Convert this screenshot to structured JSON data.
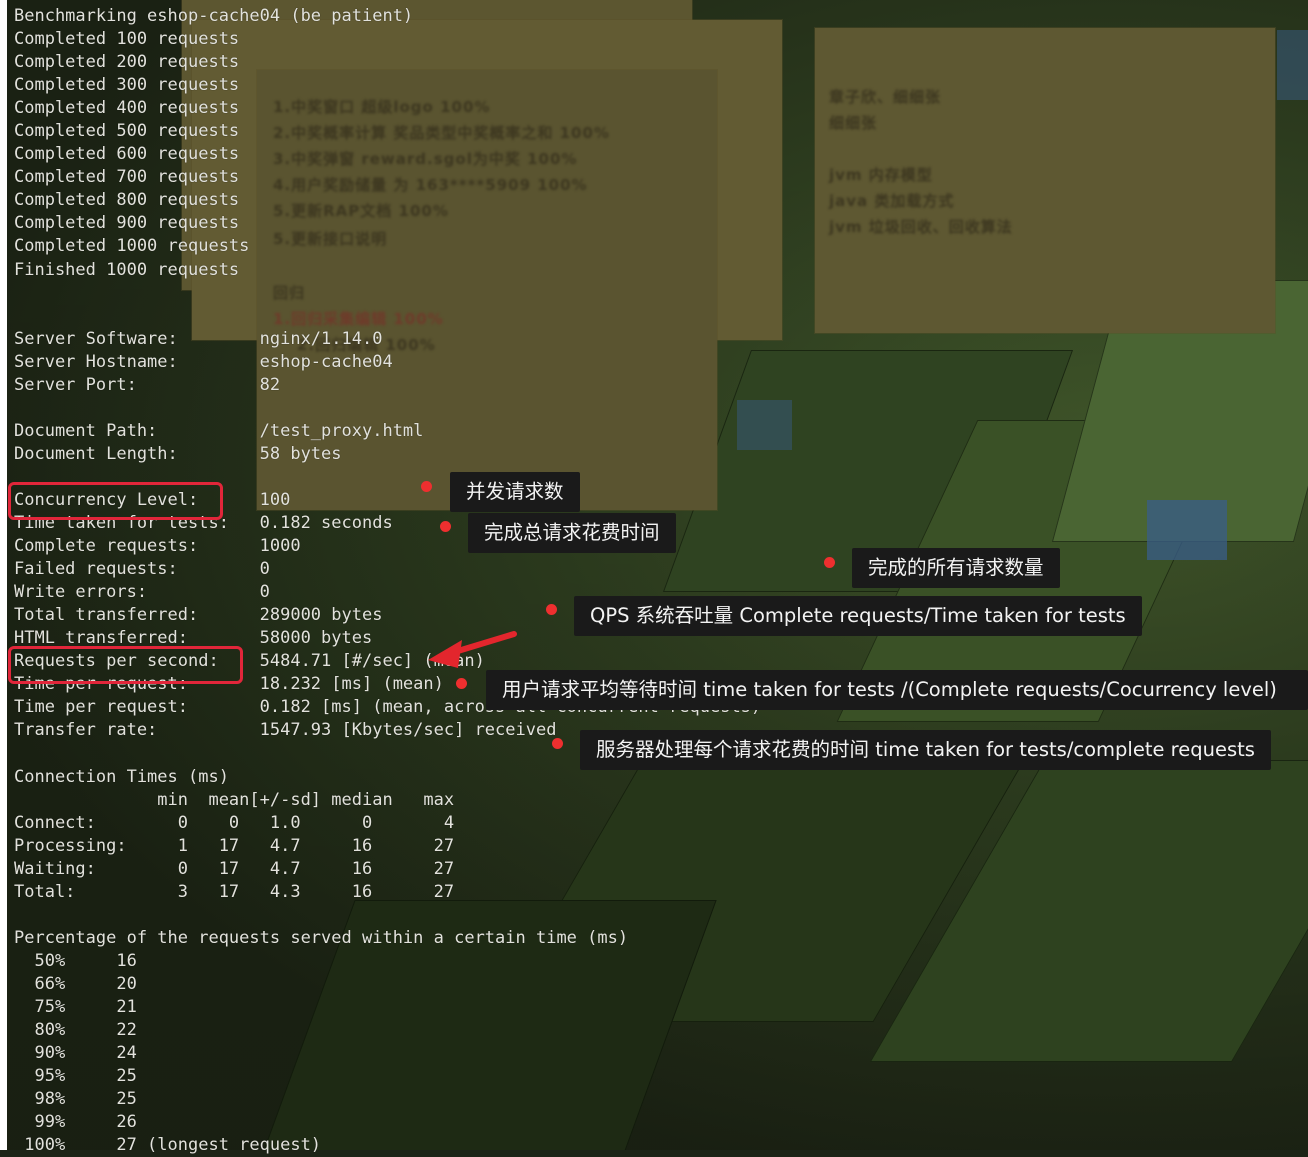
{
  "terminal": {
    "lines": [
      "Benchmarking eshop-cache04 (be patient)",
      "Completed 100 requests",
      "Completed 200 requests",
      "Completed 300 requests",
      "Completed 400 requests",
      "Completed 500 requests",
      "Completed 600 requests",
      "Completed 700 requests",
      "Completed 800 requests",
      "Completed 900 requests",
      "Completed 1000 requests",
      "Finished 1000 requests",
      "",
      "",
      "Server Software:        nginx/1.14.0",
      "Server Hostname:        eshop-cache04",
      "Server Port:            82",
      "",
      "Document Path:          /test_proxy.html",
      "Document Length:        58 bytes",
      "",
      "Concurrency Level:      100",
      "Time taken for tests:   0.182 seconds",
      "Complete requests:      1000",
      "Failed requests:        0",
      "Write errors:           0",
      "Total transferred:      289000 bytes",
      "HTML transferred:       58000 bytes",
      "Requests per second:    5484.71 [#/sec] (mean)",
      "Time per request:       18.232 [ms] (mean)",
      "Time per request:       0.182 [ms] (mean, across all concurrent requests)",
      "Transfer rate:          1547.93 [Kbytes/sec] received",
      "",
      "Connection Times (ms)",
      "              min  mean[+/-sd] median   max",
      "Connect:        0    0   1.0      0       4",
      "Processing:     1   17   4.7     16      27",
      "Waiting:        0   17   4.7     16      27",
      "Total:          3   17   4.3     16      27",
      "",
      "Percentage of the requests served within a certain time (ms)",
      "  50%     16",
      "  66%     20",
      "  75%     21",
      "  80%     22",
      "  90%     24",
      "  95%     25",
      "  98%     25",
      "  99%     26",
      " 100%     27 (longest request)"
    ]
  },
  "annotations": {
    "concurrency": "并发请求数",
    "time_taken": "完成总请求花费时间",
    "complete_requests": "完成的所有请求数量",
    "qps": "QPS 系统吞吐量 Complete requests/Time taken for tests",
    "time_per_request_user": "用户请求平均等待时间  time taken for tests /(Complete requests/Cocurrency level)",
    "time_per_request_server": "服务器处理每个请求花费的时间 time taken for tests/complete requests"
  },
  "background_notes": {
    "left_items": [
      "1.中奖窗口 超级logo 100%",
      "2.中奖概率计算 奖品类型中奖概率之和 100%",
      "3.中奖弹窗 reward.sgol为中奖 100%",
      "4.用户奖励储量 为 163****5909 100%",
      "5.更新RAP文档 100%",
      "5.更新接口说明"
    ],
    "right_items": [
      "章子欣、细细张",
      "细细张",
      "jvm 内存模型",
      "java 类加载方式",
      "jvm 垃圾回收、回收算法"
    ],
    "misc": [
      "回归",
      "1.回归采集编辑 100%",
      "2.回归编辑 100%"
    ]
  },
  "colors": {
    "highlight": "#e1263a",
    "dot": "#ee2f2f",
    "label_bg": "#1a1a1a",
    "terminal_text": "#e2e2dc"
  }
}
